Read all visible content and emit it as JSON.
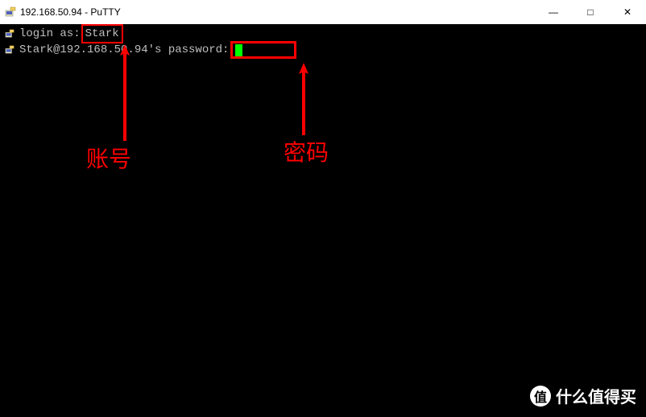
{
  "titlebar": {
    "title": "192.168.50.94 - PuTTY",
    "minimize": "—",
    "maximize": "□",
    "close": "✕"
  },
  "terminal": {
    "line1_prompt": "login as:",
    "line1_user": "Stark",
    "line2_text": "Stark@192.168.50.94's password:"
  },
  "annotations": {
    "account": "账号",
    "password": "密码"
  },
  "watermark": {
    "badge": "值",
    "text": "什么值得买"
  }
}
